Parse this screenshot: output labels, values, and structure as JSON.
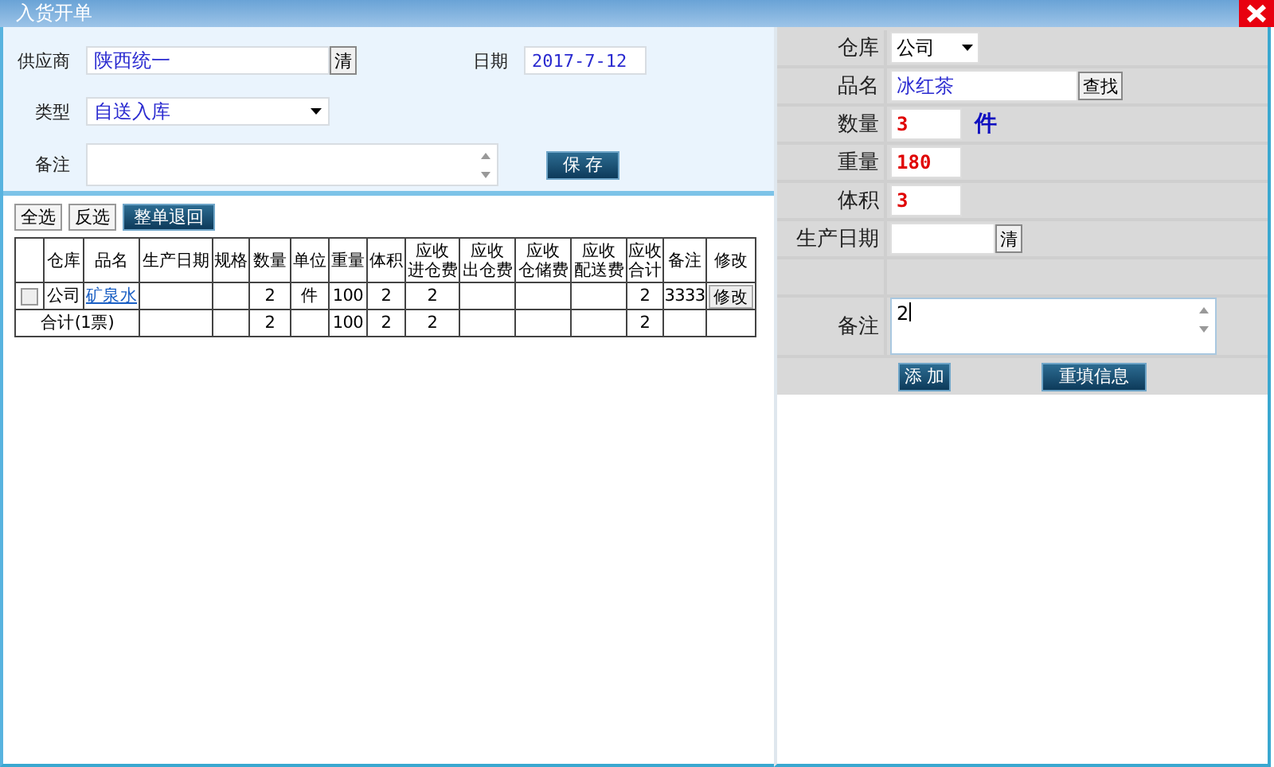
{
  "window": {
    "title": "入货开单"
  },
  "order_form": {
    "supplier": {
      "label": "供应商",
      "value": "陕西统一",
      "clear_button": "清"
    },
    "date": {
      "label": "日期",
      "value": "2017-7-12"
    },
    "type": {
      "label": "类型",
      "value": "自送入库"
    },
    "remark": {
      "label": "备注"
    },
    "save_button": "保 存"
  },
  "toolbar": [
    {
      "label": "全选",
      "kind": "plain"
    },
    {
      "label": "反选",
      "kind": "plain"
    },
    {
      "label": "整单退回",
      "kind": "dark"
    }
  ],
  "table": {
    "columns": [
      {
        "kind": "check"
      },
      {
        "label": "仓库",
        "kind": "text"
      },
      {
        "label": "品名",
        "kind": "link"
      },
      {
        "label": "生产日期",
        "kind": "text"
      },
      {
        "label": "规格",
        "kind": "text"
      },
      {
        "label": "数量",
        "kind": "text"
      },
      {
        "label": "单位",
        "kind": "text"
      },
      {
        "label": "重量",
        "kind": "text"
      },
      {
        "label": "体积",
        "kind": "text"
      },
      {
        "label": "应收进仓费",
        "kind": "text"
      },
      {
        "label": "应收出仓费",
        "kind": "text"
      },
      {
        "label": "应收仓储费",
        "kind": "text"
      },
      {
        "label": "应收配送费",
        "kind": "text"
      },
      {
        "label": "应收合计",
        "kind": "text"
      },
      {
        "label": "备注",
        "kind": "text"
      },
      {
        "label": "修改",
        "kind": "button"
      }
    ],
    "rows": [
      {
        "checked": false,
        "cells": [
          null,
          "公司",
          "矿泉水",
          null,
          null,
          "2",
          "件",
          "100",
          "2",
          "2",
          null,
          null,
          null,
          "2",
          "3333",
          "修改"
        ]
      }
    ],
    "total_row": {
      "label": "合计(1票)",
      "cells": [
        null,
        null,
        "2",
        null,
        "100",
        "2",
        "2",
        null,
        null,
        null,
        "2",
        null,
        null
      ]
    }
  },
  "item_editor": {
    "fields": [
      {
        "kind": "select",
        "label": "仓库",
        "value": "公司"
      },
      {
        "kind": "lookup",
        "label": "品名",
        "value": "冰红茶",
        "button": "查找"
      },
      {
        "kind": "number",
        "label": "数量",
        "value": "3",
        "unit": "件"
      },
      {
        "kind": "number",
        "label": "重量",
        "value": "180"
      },
      {
        "kind": "number",
        "label": "体积",
        "value": "3"
      },
      {
        "kind": "date",
        "label": "生产日期",
        "button": "清"
      },
      {
        "kind": "blank"
      },
      {
        "kind": "textarea",
        "label": "备注",
        "value": "2"
      }
    ],
    "buttons": [
      {
        "label": "添 加",
        "kind": "add"
      },
      {
        "label": "重填信息",
        "kind": "reset"
      }
    ]
  }
}
